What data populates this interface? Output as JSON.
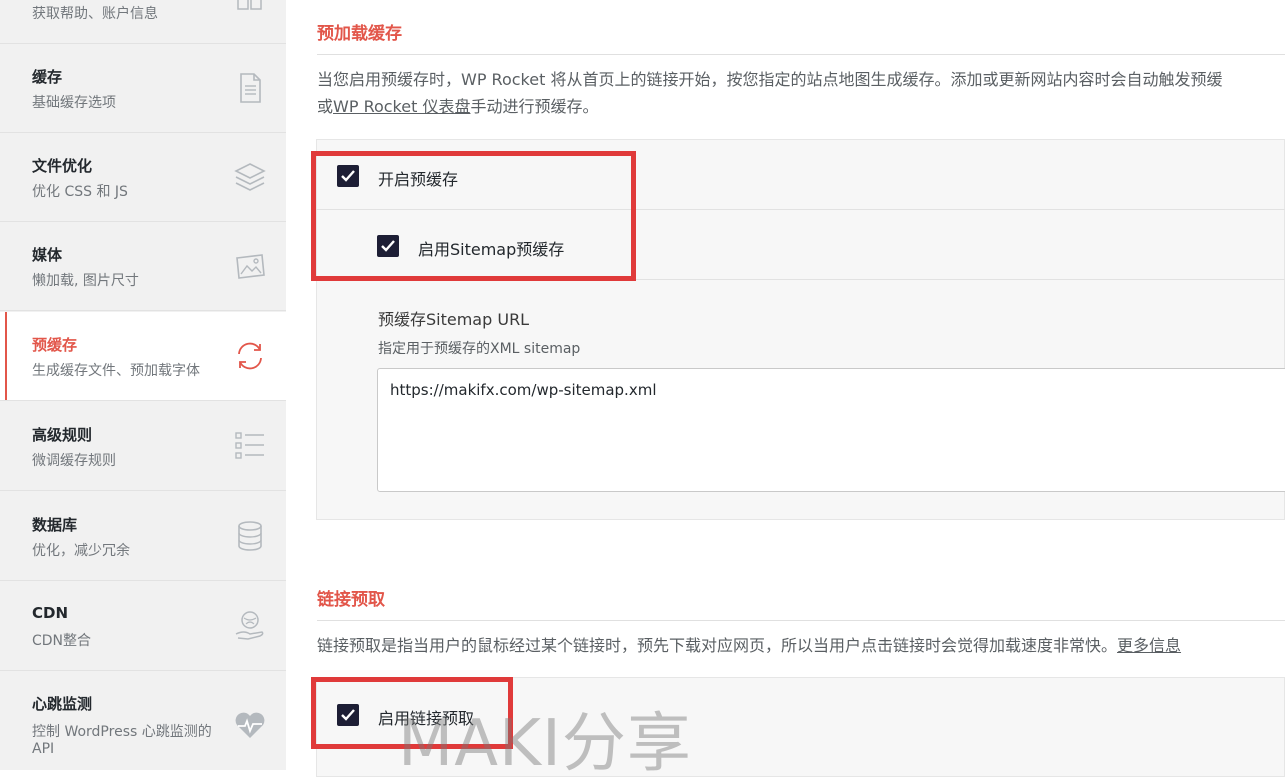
{
  "sidebar": {
    "items": [
      {
        "title": "",
        "sub": "获取帮助、账户信息",
        "icon": "help-book-icon"
      },
      {
        "title": "缓存",
        "sub": "基础缓存选项",
        "icon": "file-icon"
      },
      {
        "title": "文件优化",
        "sub": "优化 CSS 和 JS",
        "icon": "layers-icon"
      },
      {
        "title": "媒体",
        "sub": "懒加载, 图片尺寸",
        "icon": "image-icon"
      },
      {
        "title": "预缓存",
        "sub": "生成缓存文件、预加载字体",
        "icon": "refresh-icon"
      },
      {
        "title": "高级规则",
        "sub": "微调缓存规则",
        "icon": "checklist-icon"
      },
      {
        "title": "数据库",
        "sub": "优化，减少冗余",
        "icon": "database-icon"
      },
      {
        "title": "CDN",
        "sub": "CDN整合",
        "icon": "cdn-hand-icon"
      },
      {
        "title": "心跳监测",
        "sub": "控制 WordPress 心跳监测的",
        "sub2": "API",
        "icon": "heartbeat-icon"
      }
    ],
    "active_index": 4
  },
  "preload": {
    "title": "预加载缓存",
    "desc_line1": "当您启用预缓存时，WP Rocket 将从首页上的链接开始，按您指定的站点地图生成缓存。添加或更新网站内容时会自动触发预缓",
    "desc_line2_prefix": "或",
    "desc_link": "WP Rocket 仪表盘",
    "desc_line2_suffix": "手动进行预缓存。",
    "enable_label": "开启预缓存",
    "enable_checked": true,
    "sitemap_label": "启用Sitemap预缓存",
    "sitemap_checked": true,
    "sitemap_url_title": "预缓存Sitemap URL",
    "sitemap_url_hint": "指定用于预缓存的XML sitemap",
    "sitemap_url_value": "https://makifx.com/wp-sitemap.xml"
  },
  "prefetch": {
    "title": "链接预取",
    "desc": "链接预取是指当用户的鼠标经过某个链接时，预先下载对应网页，所以当用户点击链接时会觉得加载速度非常快。",
    "more_link": "更多信息",
    "enable_label": "启用链接预取",
    "enable_checked": true
  },
  "watermark": "MAKI分享",
  "colors": {
    "accent": "#e2564a",
    "highlight": "#e03a3a",
    "checkbox": "#1d1e35"
  }
}
